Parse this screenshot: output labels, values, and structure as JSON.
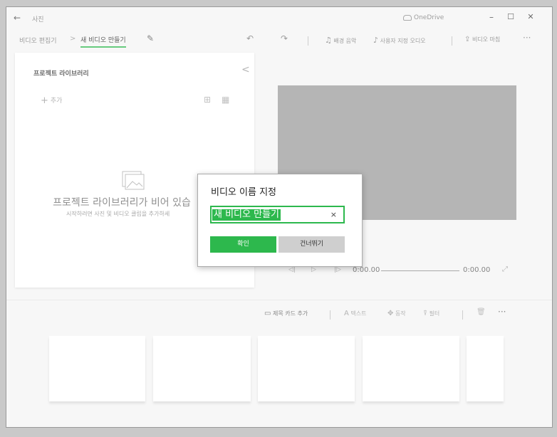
{
  "titlebar": {
    "back_icon": "←",
    "title": "사진",
    "onedrive": "OneDrive",
    "minimize": "–",
    "maximize": "☐",
    "close": "✕"
  },
  "breadcrumb": {
    "parent": "비디오 편집기",
    "separator": ">",
    "current": "새 비디오 만들기"
  },
  "toolbar": {
    "undo_icon": "↶",
    "redo_icon": "↷",
    "background_music": "배경 음악",
    "custom_audio": "사용자 지정 오디오",
    "finish_video": "비디오 마침",
    "more": "···"
  },
  "library": {
    "title": "프로젝트 라이브러리",
    "collapse_icon": "<",
    "add": "추가",
    "add_icon": "+",
    "empty_title": "프로젝트 라이브러리가 비어 있습",
    "empty_subtitle": "시작하려면 사진 및 비디오 클립을 추가하세"
  },
  "playback": {
    "rewind": "◁|",
    "play": "▷",
    "forward": "|▷",
    "current_time": "0:00.00",
    "total_time": "0:00.00",
    "expand": "⤢"
  },
  "storyboard": {
    "add_title_card": "제목 카드 추가",
    "text": "텍스트",
    "motion": "동작",
    "filter": "필터",
    "delete_icon": "🗑",
    "more": "···"
  },
  "dialog": {
    "title": "비디오 이름 지정",
    "input_value": "새 비디오 만들기",
    "clear_icon": "×",
    "ok": "확인",
    "skip": "건너뛰기"
  },
  "colors": {
    "accent": "#2db84d",
    "preview": "#999999"
  }
}
